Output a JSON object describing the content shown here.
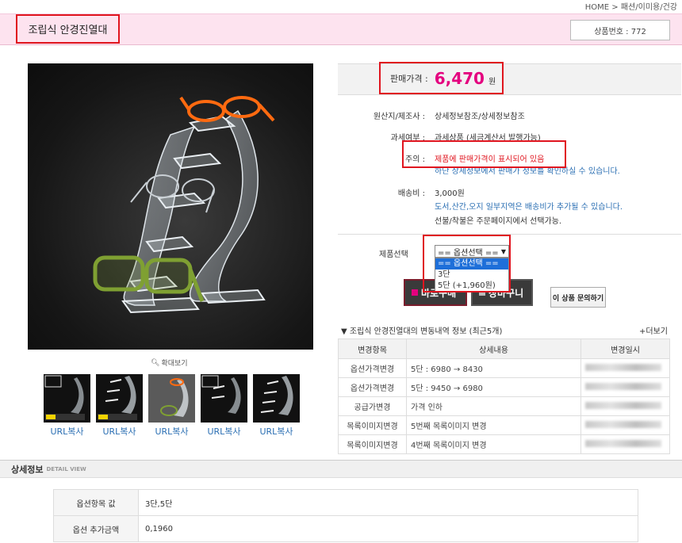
{
  "breadcrumb": "HOME > 패션/이미용/건강",
  "product": {
    "title": "조립식 안경진열대",
    "product_no": "상품번호 : 772"
  },
  "price": {
    "label": "판매가격 :",
    "value": "6,470",
    "unit": "원"
  },
  "info": {
    "origin_label": "원산지/제조사 :",
    "origin_value": "상세정보참조/상세정보참조",
    "tax_label": "과세여부 :",
    "tax_value": "과세상품 (세금계산서 발행가능)",
    "notice_label": "주의 :",
    "notice_line1": "제품에 판매가격이 표시되어 있음",
    "notice_line2": "하단 상세정보에서 판매가 정보를 확인하실 수 있습니다.",
    "shipping_label": "배송비 :",
    "shipping_value": "3,000원",
    "shipping_note1": "도서,산간,오지 일부지역은 배송비가 추가될 수 있습니다.",
    "shipping_note2": "선불/착불은 주문페이지에서 선택가능."
  },
  "option": {
    "label": "제품선택",
    "selected": "== 옵션선택 ==",
    "options": [
      "== 옵션선택 ==",
      "3단",
      "5단 (+1,960원)"
    ]
  },
  "buttons": {
    "buy": "바로구매",
    "cart": "장바구니",
    "ask": "이 상품 문의하기"
  },
  "gallery": {
    "zoom_label": "확대보기",
    "url_copy": "URL복사",
    "thumb_count": 5
  },
  "history": {
    "title": "▼ 조립식 안경진열대의 변동내역 정보 (최근5개)",
    "more": "+더보기",
    "headers": [
      "변경항목",
      "상세내용",
      "변경일시"
    ],
    "rows": [
      {
        "item": "옵션가격변경",
        "detail": "5단 : 6980 → 8430"
      },
      {
        "item": "옵션가격변경",
        "detail": "5단 : 9450 → 6980"
      },
      {
        "item": "공급가변경",
        "detail": "가격 인하"
      },
      {
        "item": "목록이미지변경",
        "detail": "5번째 목록이미지 변경"
      },
      {
        "item": "목록이미지변경",
        "detail": "4번째 목록이미지 변경"
      }
    ]
  },
  "detail": {
    "title": "상세정보",
    "subtitle": "DETAIL VIEW",
    "rows": [
      {
        "key": "옵션항목 값",
        "value": "3단,5단"
      },
      {
        "key": "옵션 추가금액",
        "value": "0,1960"
      }
    ]
  },
  "colors": {
    "accent_pink": "#e4007f",
    "header_bg": "#fde3ef",
    "highlight_red": "#e0151f",
    "link_blue": "#2b6fb3"
  }
}
